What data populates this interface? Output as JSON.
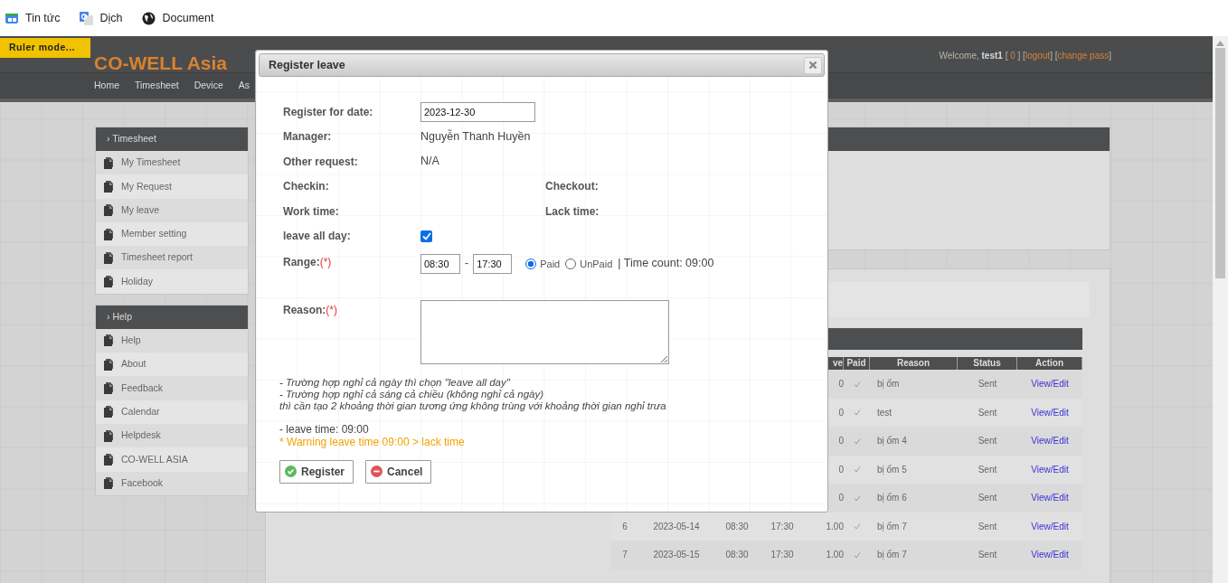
{
  "bookmarks": [
    {
      "label": "Tin tức",
      "kind": "news"
    },
    {
      "label": "Dịch",
      "kind": "translate"
    },
    {
      "label": "Document",
      "kind": "globe"
    }
  ],
  "ruler_badge": "Ruler mode...",
  "header": {
    "logo": "CO-WELL Asia",
    "welcome": "Welcome,",
    "user": "test1",
    "links": [
      {
        "open": "[ ",
        "label": "0",
        "close": " ]"
      },
      {
        "open": "[",
        "label": "logout",
        "close": "]"
      },
      {
        "open": "[",
        "label": "change pass",
        "close": "]"
      }
    ]
  },
  "nav": [
    "Home",
    "Timesheet",
    "Device",
    "As"
  ],
  "sidebar": [
    {
      "title": "› Timesheet",
      "items": [
        "My Timesheet",
        "My Request",
        "My leave",
        "Member setting",
        "Timesheet report",
        "Holiday"
      ]
    },
    {
      "title": "› Help",
      "items": [
        "Help",
        "About",
        "Feedback",
        "Calendar",
        "Helpdesk",
        "CO-WELL ASIA",
        "Facebook"
      ]
    }
  ],
  "table": {
    "columns": [
      "ve",
      "Paid",
      "Reason",
      "Status",
      "Action"
    ],
    "rows": [
      {
        "leave": "0",
        "paid": true,
        "reason": "bị ốm",
        "status": "Sent",
        "action": "View/Edit"
      },
      {
        "leave": "0",
        "paid": true,
        "reason": "test",
        "status": "Sent",
        "action": "View/Edit"
      },
      {
        "leave": "0",
        "paid": true,
        "reason": "bị ốm 4",
        "status": "Sent",
        "action": "View/Edit"
      },
      {
        "leave": "0",
        "paid": true,
        "reason": "bị ốm 5",
        "status": "Sent",
        "action": "View/Edit"
      },
      {
        "leave": "0",
        "paid": true,
        "reason": "bị ốm 6",
        "status": "Sent",
        "action": "View/Edit"
      },
      {
        "no": "6",
        "date": "2023-05-14",
        "start": "08:30",
        "end": "17:30",
        "leave": "1.00",
        "paid": true,
        "reason": "bị ốm 7",
        "status": "Sent",
        "action": "View/Edit"
      },
      {
        "no": "7",
        "date": "2023-05-15",
        "start": "08:30",
        "end": "17:30",
        "leave": "1.00",
        "paid": true,
        "reason": "bị ốm 7",
        "status": "Sent",
        "action": "View/Edit"
      }
    ]
  },
  "dialog": {
    "title": "Register leave",
    "date_label": "Register for date:",
    "date_value": "2023-12-30",
    "manager_label": "Manager:",
    "manager": "Nguyễn Thanh Huyền",
    "other_label": "Other request:",
    "other": "N/A",
    "checkin_label": "Checkin:",
    "checkout_label": "Checkout:",
    "worktime_label": "Work time:",
    "lacktime_label": "Lack time:",
    "allday_label": "leave all day:",
    "allday_checked": true,
    "range_label": "Range:",
    "range_required": "(*)",
    "range_from": "08:30",
    "range_sep": "-",
    "range_to": "17:30",
    "pay_options": [
      {
        "label": "Paid",
        "selected": true
      },
      {
        "label": "UnPaid",
        "selected": false
      }
    ],
    "time_count": "| Time count: 09:00",
    "reason_label": "Reason:",
    "reason_required": "(*)",
    "notes": [
      "- Trường hợp nghỉ cả ngày thì chọn \"leave all day\"",
      "- Trường hợp nghỉ cả sáng cả chiều (không nghỉ cả ngày)",
      "thì cần tạo 2 khoảng thời gian tương ứng không trùng với khoảng thời gian nghỉ trưa"
    ],
    "leave_time": "- leave time: 09:00",
    "warning": "* Warning leave time 09:00 > lack time",
    "buttons": [
      {
        "label": "Register",
        "kind": "ok"
      },
      {
        "label": "Cancel",
        "kind": "cancel"
      }
    ]
  }
}
